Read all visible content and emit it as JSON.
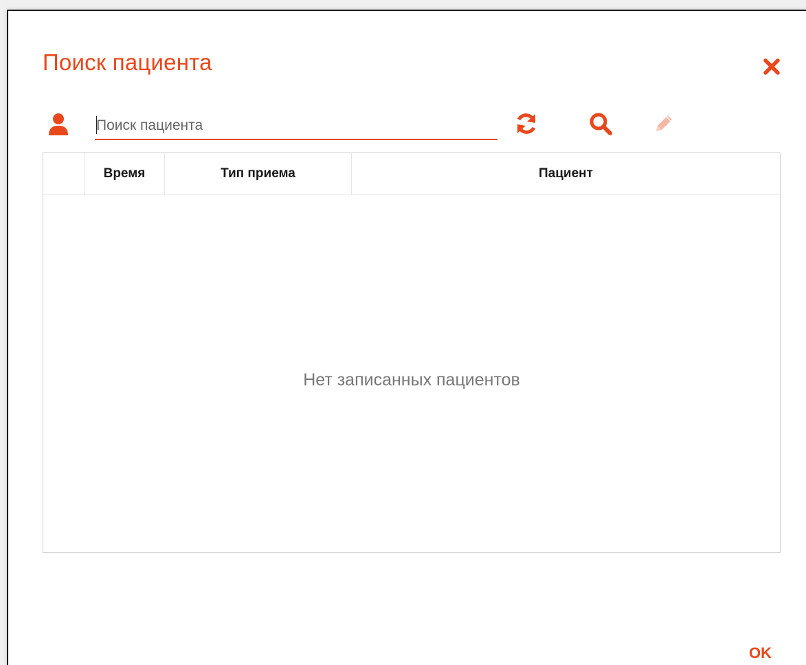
{
  "dialog": {
    "title": "Поиск пациента",
    "accent_color": "#e8481c",
    "close_icon": "close-icon"
  },
  "search": {
    "placeholder": "Поиск пациента",
    "value": "",
    "user_icon": "user-icon",
    "refresh_icon": "refresh-icon",
    "search_icon": "search-icon",
    "edit_icon": "pencil-icon",
    "edit_disabled": true
  },
  "table": {
    "columns": [
      "",
      "Время",
      "Тип приема",
      "Пациент"
    ],
    "rows": [],
    "empty_message": "Нет записанных пациентов"
  },
  "footer": {
    "ok_label": "OK"
  }
}
